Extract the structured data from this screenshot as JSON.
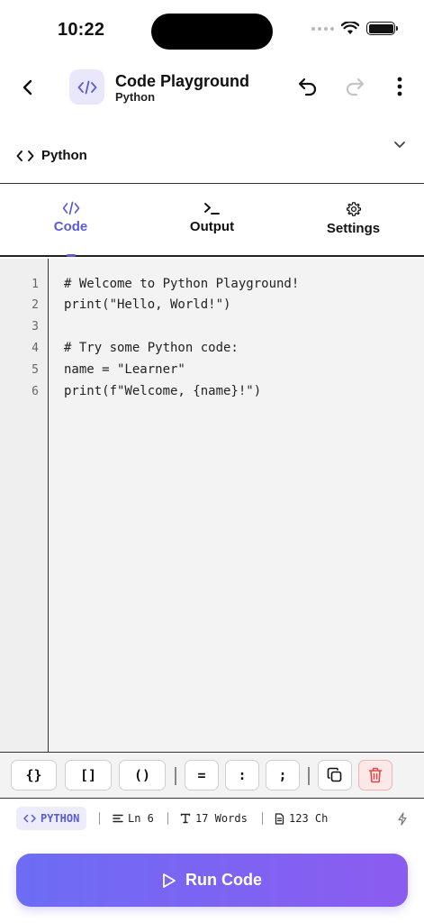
{
  "status_bar": {
    "time": "10:22"
  },
  "header": {
    "title": "Code Playground",
    "subtitle": "Python"
  },
  "language_selector": {
    "label": "Python"
  },
  "tabs": [
    {
      "label": "Code",
      "icon": "code-icon",
      "active": true
    },
    {
      "label": "Output",
      "icon": "terminal-icon",
      "active": false
    },
    {
      "label": "Settings",
      "icon": "gear-icon",
      "active": false
    }
  ],
  "editor": {
    "line_numbers": [
      "1",
      "2",
      "3",
      "4",
      "5",
      "6"
    ],
    "lines": [
      "# Welcome to Python Playground!",
      "print(\"Hello, World!\")",
      "",
      "# Try some Python code:",
      "name = \"Learner\"",
      "print(f\"Welcome, {name}!\")"
    ]
  },
  "symbols": [
    "{}",
    "[]",
    "()",
    "=",
    ":",
    ";"
  ],
  "status_strip": {
    "language": "PYTHON",
    "line": "Ln 6",
    "words": "17 Words",
    "chars": "123 Ch"
  },
  "run_button": {
    "label": "Run Code"
  },
  "colors": {
    "accent": "#5b5bd6",
    "run_gradient_start": "#6c6cf5",
    "run_gradient_end": "#8c5cf0",
    "danger": "#e04848"
  }
}
